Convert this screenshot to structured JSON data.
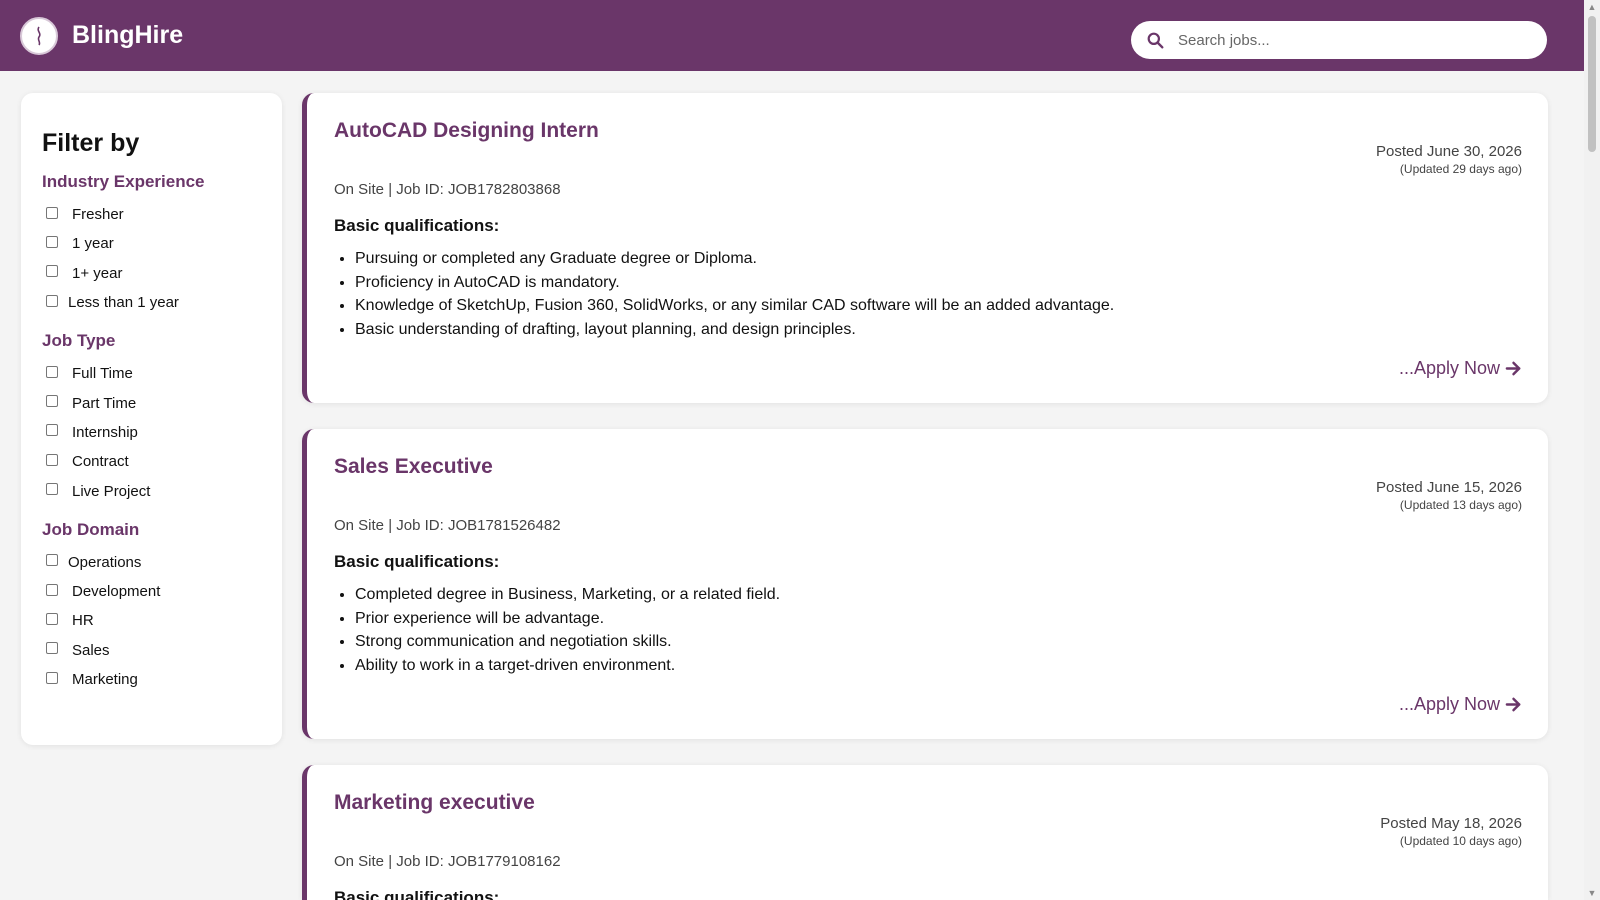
{
  "app": {
    "name": "BlingHire"
  },
  "search": {
    "placeholder": "Search jobs..."
  },
  "filters": {
    "title": "Filter by",
    "sections": [
      {
        "title": "Industry Experience",
        "options": [
          "Fresher",
          "1 year",
          "1+ year",
          "Less than 1 year"
        ]
      },
      {
        "title": "Job Type",
        "options": [
          "Full Time",
          "Part Time",
          "Internship",
          "Contract",
          "Live Project"
        ]
      },
      {
        "title": "Job Domain",
        "options": [
          "Operations",
          "Development",
          "HR",
          "Sales",
          "Marketing"
        ]
      }
    ]
  },
  "jobs": [
    {
      "title": "AutoCAD Designing Intern",
      "posted": "Posted June 30, 2026",
      "updated": "(Updated 29 days ago)",
      "meta": "On Site | Job ID: JOB1782803868",
      "qual_heading": "Basic qualifications:",
      "qualifications": [
        "Pursuing or completed any Graduate degree or Diploma.",
        "Proficiency in AutoCAD is mandatory.",
        "Knowledge of SketchUp, Fusion 360, SolidWorks, or any similar CAD software will be an added advantage.",
        "Basic understanding of drafting, layout planning, and design principles."
      ],
      "apply": "...Apply Now"
    },
    {
      "title": "Sales Executive",
      "posted": "Posted June 15, 2026",
      "updated": "(Updated 13 days ago)",
      "meta": "On Site | Job ID: JOB1781526482",
      "qual_heading": "Basic qualifications:",
      "qualifications": [
        "Completed degree in Business, Marketing, or a related field.",
        "Prior experience will be advantage.",
        "Strong communication and negotiation skills.",
        "Ability to work in a target-driven environment."
      ],
      "apply": "...Apply Now"
    },
    {
      "title": "Marketing executive",
      "posted": "Posted May 18, 2026",
      "updated": "(Updated 10 days ago)",
      "meta": "On Site | Job ID: JOB1779108162",
      "qual_heading": "Basic qualifications:",
      "qualifications": [],
      "apply": ""
    }
  ],
  "colors": {
    "brand": "#6a3669",
    "background": "#f4f4f4"
  }
}
